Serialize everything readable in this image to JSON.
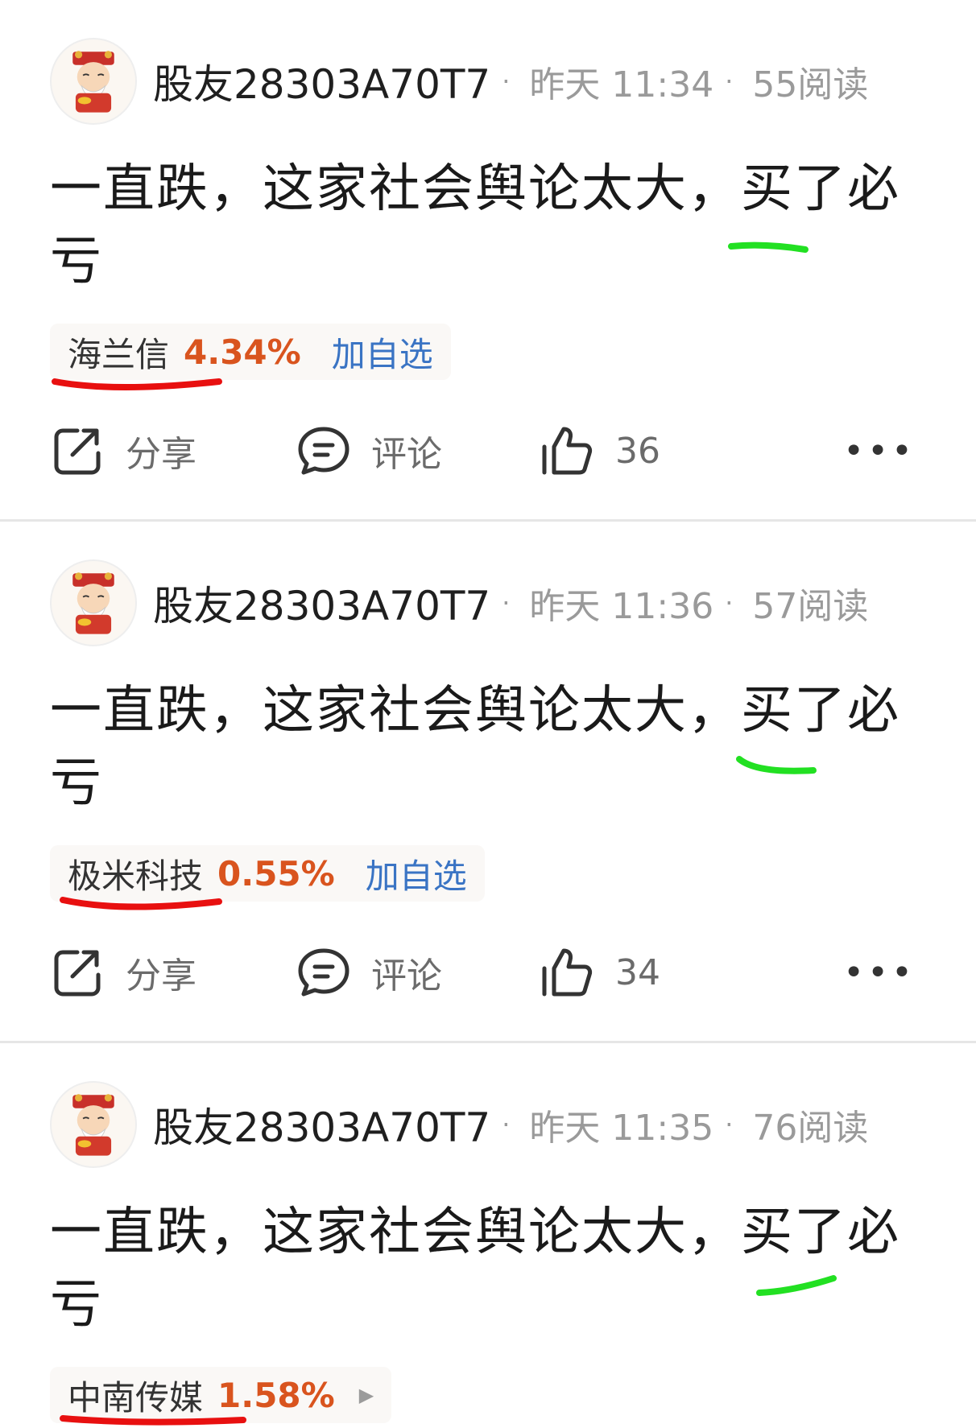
{
  "posts": [
    {
      "username": "股友28303A70T7",
      "time": "昨天 11:34",
      "reads": "55阅读",
      "text": "一直跌，这家社会舆论太大，买了必亏",
      "stock": {
        "name": "海兰信",
        "change": "4.34%",
        "action": "加自选"
      },
      "actions": {
        "share": "分享",
        "comment": "评论",
        "likes": "36"
      }
    },
    {
      "username": "股友28303A70T7",
      "time": "昨天 11:36",
      "reads": "57阅读",
      "text": "一直跌，这家社会舆论太大，买了必亏",
      "stock": {
        "name": "极米科技",
        "change": "0.55%",
        "action": "加自选"
      },
      "actions": {
        "share": "分享",
        "comment": "评论",
        "likes": "34"
      }
    },
    {
      "username": "股友28303A70T7",
      "time": "昨天 11:35",
      "reads": "76阅读",
      "text": "一直跌，这家社会舆论太大，买了必亏",
      "stock": {
        "name": "中南传媒",
        "change": "1.58%",
        "arrow": "▶"
      }
    }
  ],
  "icons": {
    "share": "share-icon",
    "comment": "comment-icon",
    "like": "thumbs-up-icon",
    "more": "more-dots-icon"
  },
  "colors": {
    "stock_change": "#d9541e",
    "add_favorite": "#3a74c4",
    "annotation_green": "#22e022",
    "annotation_red": "#e81010"
  }
}
